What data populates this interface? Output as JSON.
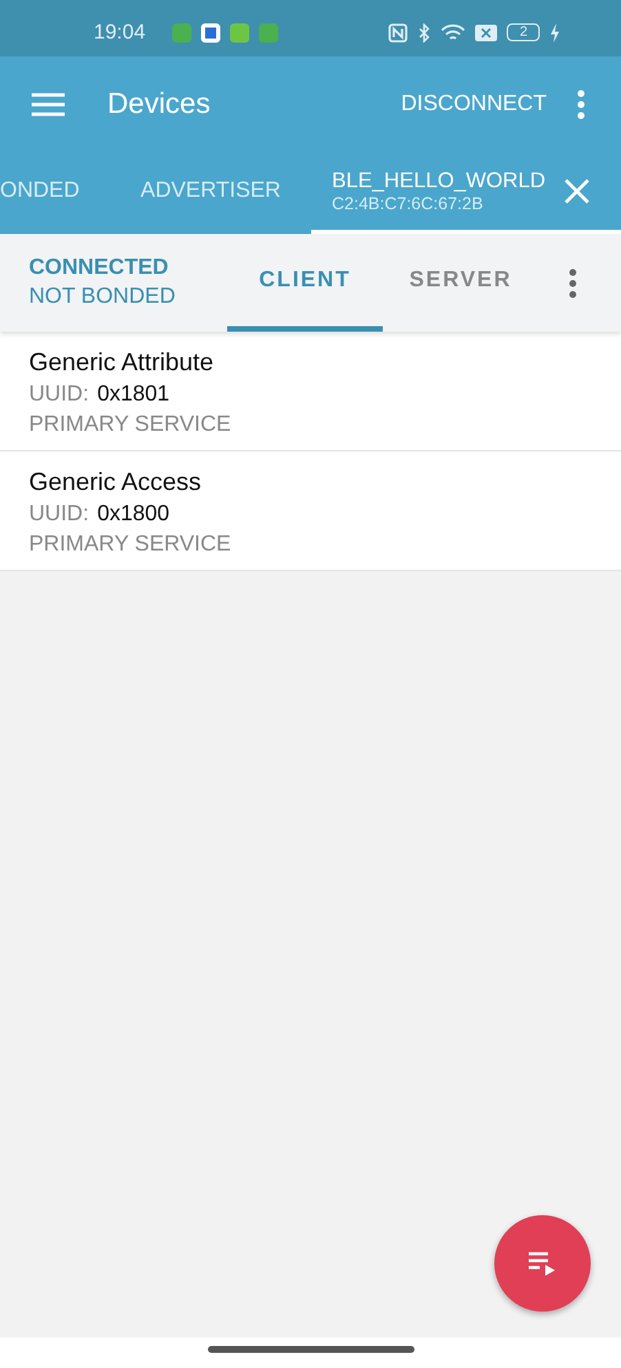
{
  "status_bar": {
    "time": "19:04",
    "battery": "2"
  },
  "app_bar": {
    "title": "Devices",
    "action": "DISCONNECT"
  },
  "device_tabs": [
    {
      "label": "ONDED",
      "selected": false
    },
    {
      "label": "ADVERTISER",
      "selected": false
    },
    {
      "label": "BLE_HELLO_WORLD",
      "address": "C2:4B:C7:6C:67:2B",
      "selected": true
    }
  ],
  "connection": {
    "state": "CONNECTED",
    "bond": "NOT BONDED"
  },
  "mode_tabs": [
    {
      "label": "CLIENT",
      "selected": true
    },
    {
      "label": "SERVER",
      "selected": false
    }
  ],
  "services": [
    {
      "name": "Generic Attribute",
      "uuid_label": "UUID:",
      "uuid": "0x1801",
      "type": "PRIMARY SERVICE"
    },
    {
      "name": "Generic Access",
      "uuid_label": "UUID:",
      "uuid": "0x1800",
      "type": "PRIMARY SERVICE"
    }
  ]
}
